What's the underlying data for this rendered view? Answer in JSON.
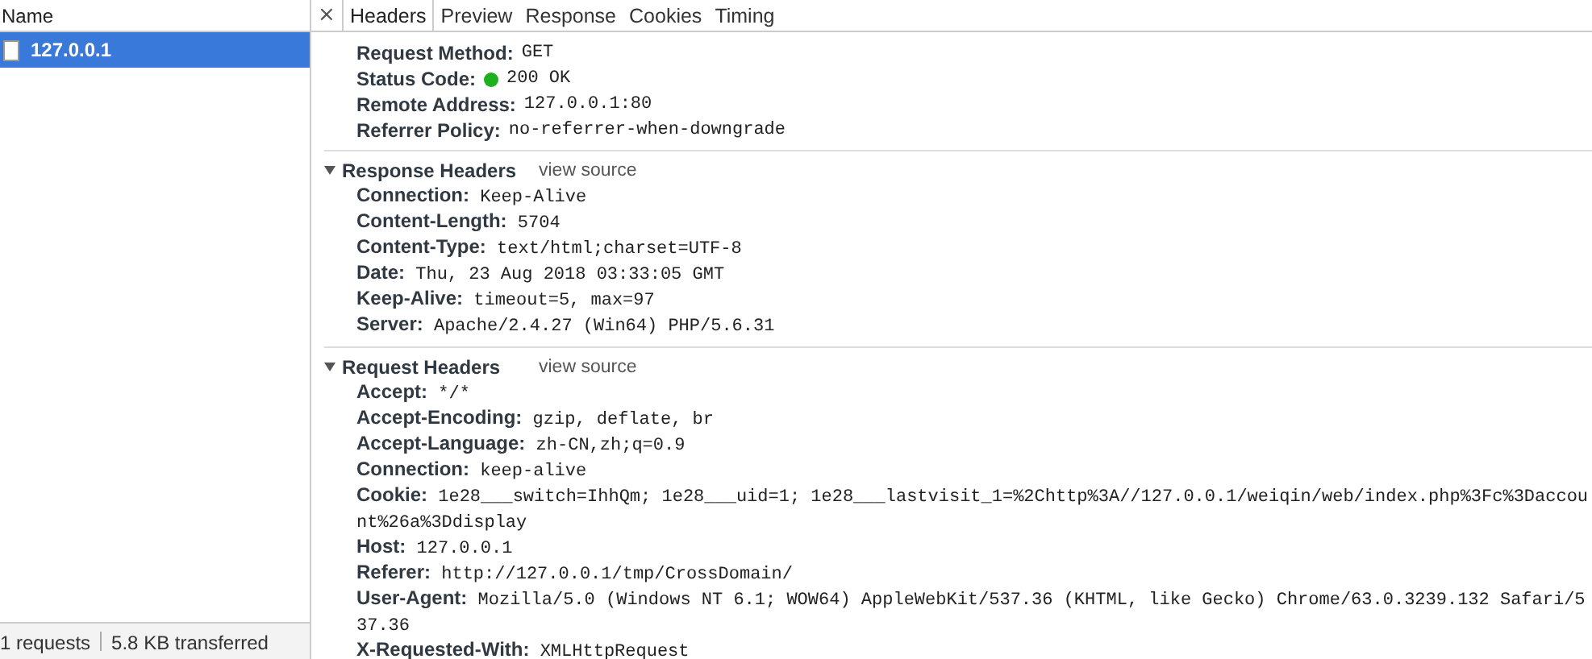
{
  "requests_panel": {
    "column_header": "Name",
    "rows": [
      {
        "name": "127.0.0.1",
        "selected": true
      }
    ],
    "status_bar": {
      "requests": "1 requests",
      "transferred": "5.8 KB transferred"
    }
  },
  "details_panel": {
    "close": "×",
    "tabs": [
      {
        "label": "Headers",
        "selected": true
      },
      {
        "label": "Preview",
        "selected": false
      },
      {
        "label": "Response",
        "selected": false
      },
      {
        "label": "Cookies",
        "selected": false
      },
      {
        "label": "Timing",
        "selected": false
      }
    ],
    "general": [
      {
        "name": "Request Method:",
        "value": "GET"
      },
      {
        "name": "Status Code:",
        "value": "200 OK",
        "color": "#1db11d"
      },
      {
        "name": "Remote Address:",
        "value": "127.0.0.1:80"
      },
      {
        "name": "Referrer Policy:",
        "value": "no-referrer-when-downgrade"
      }
    ],
    "sections": [
      {
        "title": "Response Headers",
        "expanded": true,
        "link": "view source",
        "headers": [
          {
            "name": "Connection:",
            "value": "Keep-Alive"
          },
          {
            "name": "Content-Length:",
            "value": "5704"
          },
          {
            "name": "Content-Type:",
            "value": "text/html;charset=UTF-8"
          },
          {
            "name": "Date:",
            "value": "Thu, 23 Aug 2018 03:33:05 GMT"
          },
          {
            "name": "Keep-Alive:",
            "value": "timeout=5, max=97"
          },
          {
            "name": "Server:",
            "value": "Apache/2.4.27 (Win64) PHP/5.6.31"
          }
        ]
      },
      {
        "title": "Request Headers",
        "expanded": true,
        "link": "view source",
        "headers": [
          {
            "name": "Accept:",
            "value": "*/*"
          },
          {
            "name": "Accept-Encoding:",
            "value": "gzip, deflate, br"
          },
          {
            "name": "Accept-Language:",
            "value": "zh-CN,zh;q=0.9"
          },
          {
            "name": "Connection:",
            "value": "keep-alive"
          },
          {
            "name": "Cookie:",
            "value": "1e28___switch=IhhQm; 1e28___uid=1; 1e28___lastvisit_1=%2Chttp%3A//127.0.0.1/weiqin/web/index.php%3Fc%3Daccount%26a%3Ddisplay"
          },
          {
            "name": "Host:",
            "value": "127.0.0.1"
          },
          {
            "name": "Referer:",
            "value": "http://127.0.0.1/tmp/CrossDomain/"
          },
          {
            "name": "User-Agent:",
            "value": "Mozilla/5.0 (Windows NT 6.1; WOW64) AppleWebKit/537.36 (KHTML, like Gecko) Chrome/63.0.3239.132 Safari/537.36"
          },
          {
            "name": "X-Requested-With:",
            "value": "XMLHttpRequest"
          }
        ]
      }
    ]
  }
}
